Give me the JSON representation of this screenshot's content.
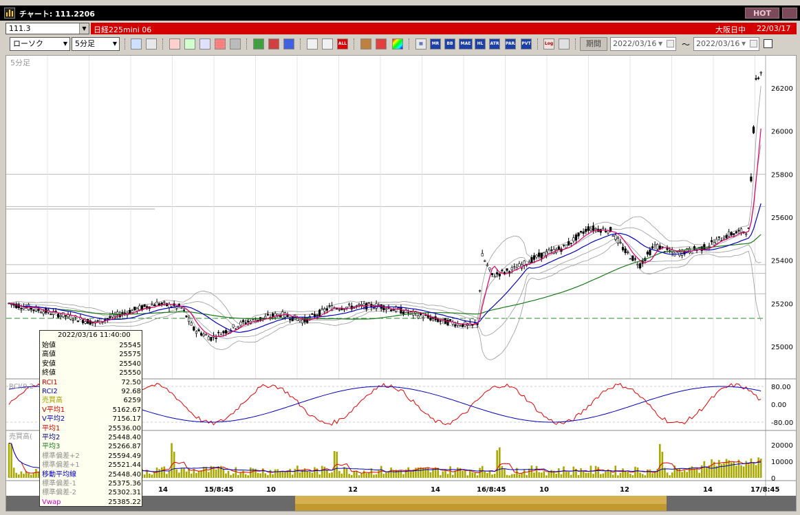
{
  "titlebar": {
    "title": "チャート: 111.2206",
    "hot_label": "HOT"
  },
  "infobar": {
    "symbol": "111.3",
    "contract": "日経225mini 06",
    "exchange": "大阪日中",
    "date": "22/03/17"
  },
  "toolbar": {
    "chart_type": "ローソク",
    "interval": "5分足",
    "period_label": "期間",
    "date_from": "2022/03/16",
    "date_to": "2022/03/16",
    "tilde": "〜",
    "buttons": [
      "MR",
      "BB",
      "MAE",
      "HL",
      "ATR",
      "PARA",
      "PVT",
      "Log"
    ],
    "all_label": "ALL"
  },
  "chart": {
    "interval_label": "5分足",
    "price_ticks": [
      "26200",
      "26000",
      "25800",
      "25600",
      "25400",
      "25200",
      "25000"
    ],
    "rci_label": "RCI(9,2",
    "rci_ticks": [
      "80.00",
      "0.00",
      "-80.00"
    ],
    "volume_label": "売買高(",
    "volume_ticks": [
      "20000",
      "10000",
      "0"
    ],
    "time_labels": [
      "14",
      "15/8:45",
      "10",
      "12",
      "14",
      "16/8:45",
      "10",
      "12",
      "14",
      "17/8:45"
    ],
    "colors": {
      "rsi1": "#e00000",
      "rsi2": "#0000c0",
      "ma1": "#e0006a",
      "ma2": "#0000c0",
      "ma3": "#1a7a1a",
      "vol": "#a8a800",
      "bb": "#9a9a9a"
    }
  },
  "chart_data": {
    "type": "candlestick",
    "title": "",
    "interval": "5分足",
    "ylim": [
      24950,
      26300
    ],
    "price_series": {
      "name": "日経225mini 06",
      "x": [
        "15/8:45",
        "15/10:00",
        "15/12:00",
        "15/14:00",
        "16/8:45",
        "16/10:00",
        "16/12:00",
        "16/14:00",
        "17/8:45"
      ],
      "close": [
        25040,
        25120,
        25180,
        25090,
        25420,
        25520,
        25470,
        25490,
        26260
      ]
    },
    "rci_range": [
      -100,
      100
    ],
    "volume_range": [
      0,
      25000
    ]
  },
  "info_panel": {
    "datetime": "2022/03/16  11:40:00",
    "rows": [
      {
        "label": "始値",
        "value": "25545",
        "color": "#000000"
      },
      {
        "label": "高値",
        "value": "25575",
        "color": "#000000"
      },
      {
        "label": "安値",
        "value": "25540",
        "color": "#000000"
      },
      {
        "label": "終値",
        "value": "25550",
        "color": "#000000"
      },
      {
        "label": "RCI1",
        "value": "72.50",
        "color": "#d00000"
      },
      {
        "label": "RCI2",
        "value": "92.68",
        "color": "#0000c0"
      },
      {
        "label": "売買高",
        "value": "6259",
        "color": "#a0a000"
      },
      {
        "label": "V平均1",
        "value": "5162.67",
        "color": "#d00000"
      },
      {
        "label": "V平均2",
        "value": "7156.17",
        "color": "#0000c0"
      },
      {
        "label": "平均1",
        "value": "25536.00",
        "color": "#d00000"
      },
      {
        "label": "平均2",
        "value": "25448.40",
        "color": "#000080"
      },
      {
        "label": "平均3",
        "value": "25266.87",
        "color": "#1a7a1a"
      },
      {
        "label": "標準偏差+2",
        "value": "25594.49",
        "color": "#909090"
      },
      {
        "label": "標準偏差+1",
        "value": "25521.44",
        "color": "#909090"
      },
      {
        "label": "移動平均線",
        "value": "25448.40",
        "color": "#0000c0"
      },
      {
        "label": "標準偏差-1",
        "value": "25375.36",
        "color": "#909090"
      },
      {
        "label": "標準偏差-2",
        "value": "25302.31",
        "color": "#909090"
      },
      {
        "label": "Vwap",
        "value": "25385.22",
        "color": "#d000d0"
      }
    ]
  }
}
